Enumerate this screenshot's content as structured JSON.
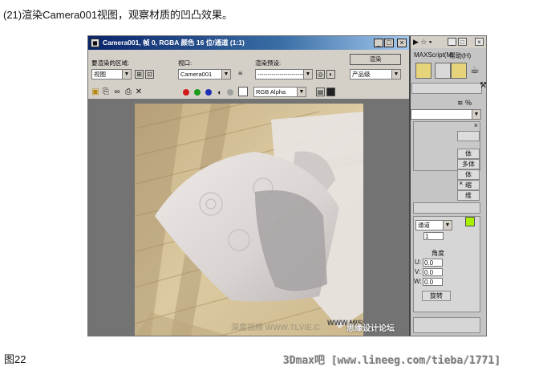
{
  "caption_top": "(21)渲染Camera001视图，观察材质的凹凸效果。",
  "caption_bottom": "图22",
  "forum_url": "3Dmax吧 [www.lineeg.com/tieba/1771]",
  "render_window": {
    "title": "Camera001, 帧 0, RGBA 颜色 16 位/通道 (1:1)",
    "area_label": "要渲染的区域:",
    "area_value": "视图",
    "viewport_label": "视口:",
    "viewport_value": "Camera001",
    "preset_label": "渲染预设:",
    "preset_value": "------------------------",
    "render_button": "渲染",
    "quality_value": "产品级",
    "channel_value": "RGB Alpha"
  },
  "command_panel": {
    "menu_maxscript": "MAXScript(M)",
    "menu_help": "帮助(H)",
    "labels": [
      "体",
      "多体",
      "体",
      "缩",
      "维"
    ],
    "channel_value": "通道",
    "count_value": "1",
    "angle_label": "角度",
    "u_label": "U:",
    "v_label": "V:",
    "w_label": "W:",
    "u_value": "0.0",
    "v_value": "0.0",
    "w_value": "0.0",
    "rotate_button": "旋转"
  },
  "watermarks": {
    "image": "思缘设计论坛",
    "site": "WWW.MISSYUAN.COM",
    "faint": "深度视频 WWW.TLVIE.C"
  },
  "colors": {
    "title_start": "#0a246a",
    "title_end": "#a6caf0",
    "highlight": "#e6d47a",
    "lime_swatch": "#a6f000"
  }
}
